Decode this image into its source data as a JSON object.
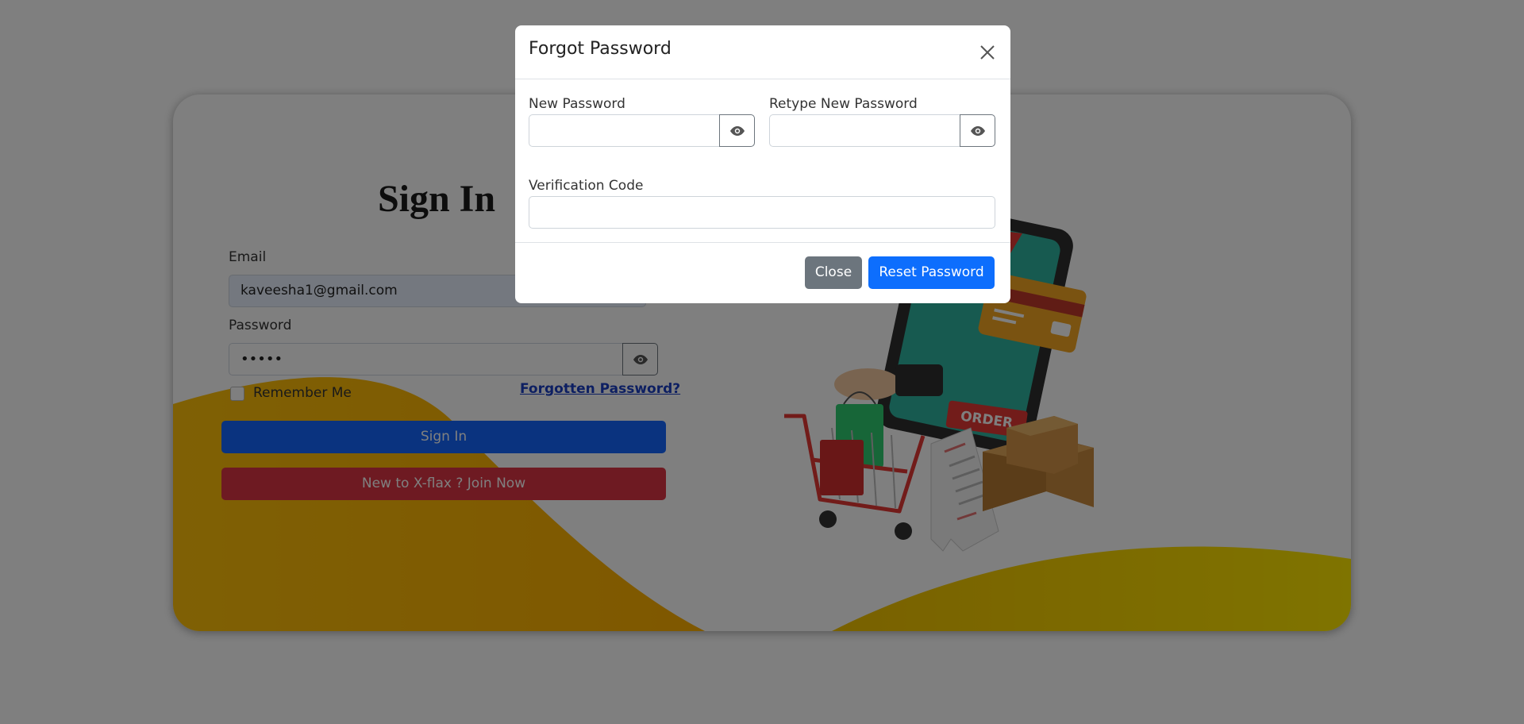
{
  "signin": {
    "title": "Sign In",
    "email_label": "Email",
    "email_value": "kaveesha1@gmail.com",
    "password_label": "Password",
    "password_value": "•••••",
    "remember_label": "Remember Me",
    "forgot_link": "Forgotten Password?",
    "signin_button": "Sign In",
    "join_button": "New to X-flax ? Join Now"
  },
  "illustration": {
    "order_tag": "ORDER"
  },
  "modal": {
    "title": "Forgot Password",
    "new_password_label": "New Password",
    "retype_password_label": "Retype New Password",
    "verification_label": "Verification Code",
    "close_button": "Close",
    "reset_button": "Reset Password"
  },
  "colors": {
    "primary": "#0d6efd",
    "danger": "#dc3545",
    "secondary": "#6c757d",
    "wave_yellow": "#ffc107"
  },
  "icons": [
    "eye-icon",
    "close-icon"
  ]
}
